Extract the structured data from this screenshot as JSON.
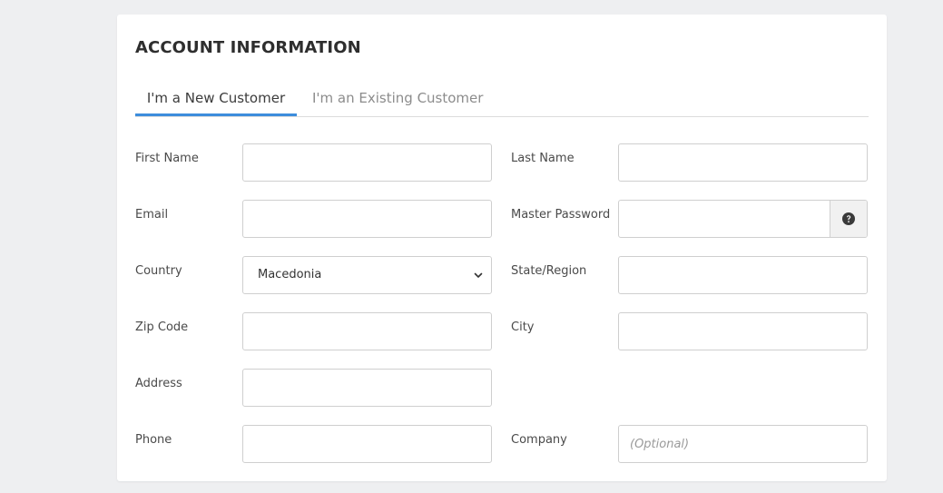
{
  "section": {
    "title": "ACCOUNT INFORMATION"
  },
  "tabs": [
    {
      "label": "I'm a New Customer",
      "active": true
    },
    {
      "label": "I'm an Existing Customer",
      "active": false
    }
  ],
  "form": {
    "first_name": {
      "label": "First Name",
      "value": ""
    },
    "last_name": {
      "label": "Last Name",
      "value": ""
    },
    "email": {
      "label": "Email",
      "value": ""
    },
    "master_password": {
      "label": "Master Password",
      "value": ""
    },
    "country": {
      "label": "Country",
      "selected": "Macedonia"
    },
    "state_region": {
      "label": "State/Region",
      "value": ""
    },
    "zip_code": {
      "label": "Zip Code",
      "value": ""
    },
    "city": {
      "label": "City",
      "value": ""
    },
    "address": {
      "label": "Address",
      "value": ""
    },
    "phone": {
      "label": "Phone",
      "value": ""
    },
    "company": {
      "label": "Company",
      "value": "",
      "placeholder": "(Optional)"
    }
  },
  "icons": {
    "password_help": "question-circle-icon",
    "country_dropdown": "chevron-down-icon"
  },
  "colors": {
    "background": "#eeeff1",
    "card": "#ffffff",
    "accent": "#3d8ddc",
    "border": "#cfcfcf",
    "inactive_tab": "#8c8c8c",
    "addon_background": "#f1f1f1"
  }
}
